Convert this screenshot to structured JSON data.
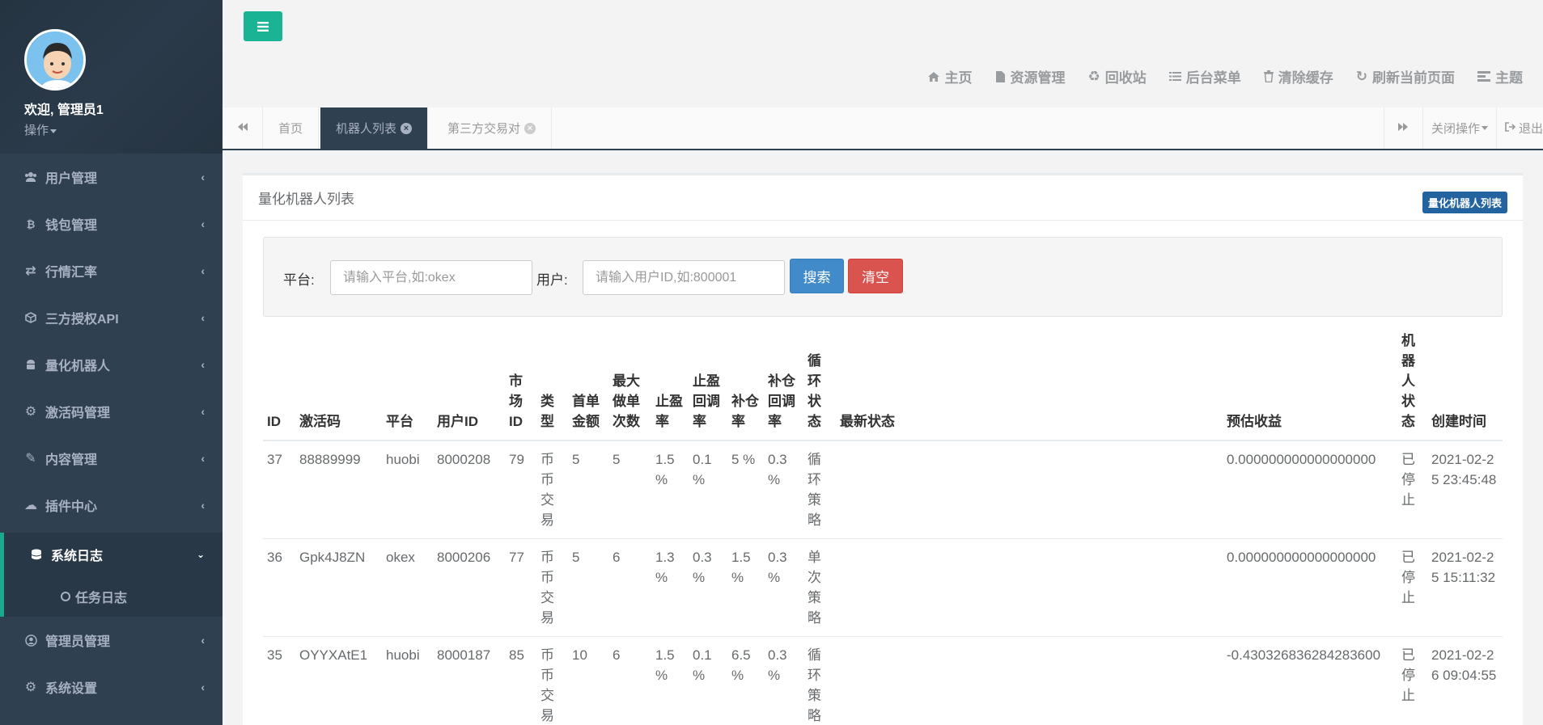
{
  "sidebar": {
    "welcome": "欢迎, 管理员1",
    "ops_label": "操作",
    "items": [
      {
        "label": "用户管理",
        "icon": "users-icon"
      },
      {
        "label": "钱包管理",
        "icon": "bitcoin-icon"
      },
      {
        "label": "行情汇率",
        "icon": "exchange-icon"
      },
      {
        "label": "三方授权API",
        "icon": "cube-icon"
      },
      {
        "label": "量化机器人",
        "icon": "android-icon"
      },
      {
        "label": "激活码管理",
        "icon": "gear-icon"
      },
      {
        "label": "内容管理",
        "icon": "edit-icon"
      },
      {
        "label": "插件中心",
        "icon": "cloud-icon"
      },
      {
        "label": "系统日志",
        "icon": "database-icon"
      },
      {
        "label": "管理员管理",
        "icon": "user-circle-icon"
      },
      {
        "label": "系统设置",
        "icon": "gears-icon"
      }
    ],
    "sub_item": "任务日志"
  },
  "header": {
    "links": [
      {
        "label": "主页",
        "icon": "home-icon"
      },
      {
        "label": "资源管理",
        "icon": "file-icon"
      },
      {
        "label": "回收站",
        "icon": "recycle-icon"
      },
      {
        "label": "后台菜单",
        "icon": "list-icon"
      },
      {
        "label": "清除缓存",
        "icon": "trash-icon"
      },
      {
        "label": "刷新当前页面",
        "icon": "refresh-icon"
      },
      {
        "label": "主题",
        "icon": "theme-icon"
      }
    ]
  },
  "tabs": {
    "home": "首页",
    "robot_list": "机器人列表",
    "third_party": "第三方交易对",
    "close_ops": "关闭操作",
    "logout": "退出"
  },
  "panel": {
    "title": "量化机器人列表",
    "badge": "量化机器人列表"
  },
  "search": {
    "platform_label": "平台:",
    "platform_placeholder": "请输入平台,如:okex",
    "user_label": "用户:",
    "user_placeholder": "请输入用户ID,如:800001",
    "search_btn": "搜索",
    "clear_btn": "清空"
  },
  "table": {
    "headers": [
      "ID",
      "激活码",
      "平台",
      "用户ID",
      "市场ID",
      "类型",
      "首单金额",
      "最大做单次数",
      "止盈率",
      "止盈回调率",
      "补仓率",
      "补仓回调率",
      "循环状态",
      "最新状态",
      "预估收益",
      "机器人状态",
      "创建时间"
    ],
    "rows": [
      [
        "37",
        "88889999",
        "huobi",
        "8000208",
        "79",
        "币币交易",
        "5",
        "5",
        "1.5 %",
        "0.1 %",
        "5 %",
        "0.3 %",
        "循环策略",
        "",
        "0.000000000000000000",
        "已停止",
        "2021-02-25 23:45:48"
      ],
      [
        "36",
        "Gpk4J8ZN",
        "okex",
        "8000206",
        "77",
        "币币交易",
        "5",
        "6",
        "1.3 %",
        "0.3 %",
        "1.5 %",
        "0.3 %",
        "单次策略",
        "",
        "0.000000000000000000",
        "已停止",
        "2021-02-25 15:11:32"
      ],
      [
        "35",
        "OYYXAtE1",
        "huobi",
        "8000187",
        "85",
        "币币交易",
        "10",
        "6",
        "1.5 %",
        "0.1 %",
        "6.5 %",
        "0.3 %",
        "循环策略",
        "",
        "-0.430326836284283600",
        "已停止",
        "2021-02-26 09:04:55"
      ]
    ]
  },
  "colors": {
    "sidebar_bg": "#2f4050",
    "accent": "#1ab394",
    "search_btn": "#428bca",
    "clear_btn": "#d9534f"
  }
}
